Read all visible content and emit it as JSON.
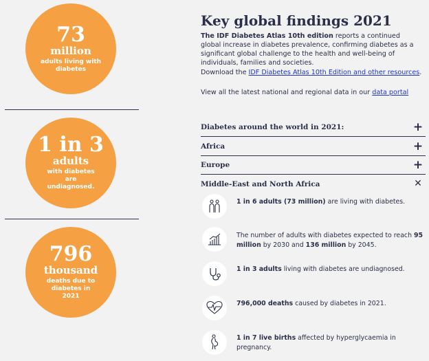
{
  "stats": [
    {
      "big": "73",
      "unit": "million",
      "desc": "adults living with diabetes"
    },
    {
      "big": "1 in 3",
      "unit": "adults",
      "desc": "with diabetes are undiagnosed."
    },
    {
      "big": "796",
      "unit": "thousand",
      "desc": "deaths due to diabetes in 2021"
    }
  ],
  "header": {
    "title": "Key global findings 2021"
  },
  "intro": {
    "bold": "The IDF Diabetes Atlas 10th edition",
    "rest": " reports a continued global increase in diabetes prevalence, confirming diabetes as a significant global challenge to the health and well-being of individuals, families and societies."
  },
  "download": {
    "prefix": "Download the ",
    "link": "IDF Diabetes Atlas 10th Edition and other resources",
    "suffix": "."
  },
  "portal": {
    "prefix": "View all the latest national and regional data in our ",
    "link": "data portal"
  },
  "accordion": [
    {
      "label": "Diabetes around the world in 2021:",
      "icon": "+"
    },
    {
      "label": "Africa",
      "icon": "+"
    },
    {
      "label": "Europe",
      "icon": "+"
    },
    {
      "label": "Middle-East and North Africa",
      "icon": "✕"
    }
  ],
  "findings": [
    {
      "icon": "people-icon",
      "b1": "1 in 6 adults (73 million)",
      "t1": " are living with diabetes.",
      "b2": "",
      "t2": "",
      "b3": "",
      "t3": ""
    },
    {
      "icon": "growth-chart-icon",
      "b1": "",
      "t1": "The number of adults with diabetes expected to reach ",
      "b2": "95 million",
      "t2": " by 2030 and ",
      "b3": "136 million",
      "t3": " by 2045."
    },
    {
      "icon": "stethoscope-icon",
      "b1": "1 in 3 adults",
      "t1": " living with diabetes are undiagnosed.",
      "b2": "",
      "t2": "",
      "b3": "",
      "t3": ""
    },
    {
      "icon": "heartbeat-icon",
      "b1": "796,000 deaths",
      "t1": " caused by diabetes in 2021.",
      "b2": "",
      "t2": "",
      "b3": "",
      "t3": ""
    },
    {
      "icon": "pregnancy-icon",
      "b1": "1 in 7 live births",
      "t1": " affected by hyperglycaemia in pregnancy.",
      "b2": "",
      "t2": "",
      "b3": "",
      "t3": ""
    }
  ],
  "colors": {
    "accent": "#f5a043",
    "text": "#2b2f4a",
    "link": "#1f36c7",
    "background": "#f2f2f2"
  }
}
